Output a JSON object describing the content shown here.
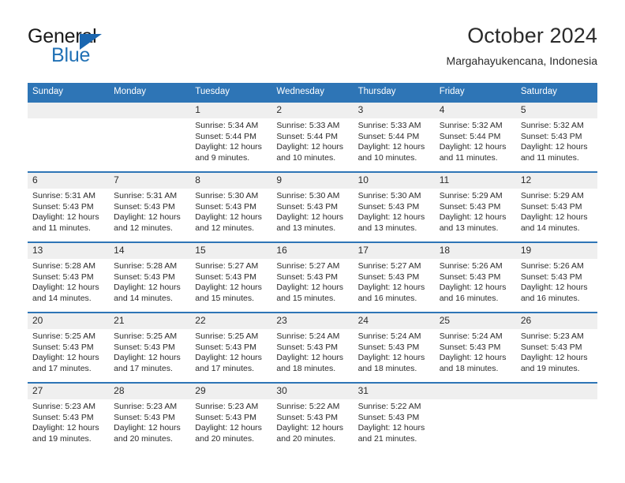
{
  "logo": {
    "word1": "General",
    "word2": "Blue",
    "triangle_color": "#1a66b0",
    "blue_color": "#2171b5"
  },
  "header": {
    "title": "October 2024",
    "subtitle": "Margahayukencana, Indonesia"
  },
  "theme": {
    "header_blue": "#2E75B6",
    "daynum_gray": "#efefef",
    "text": "#2b2b2b"
  },
  "weekdays": [
    "Sunday",
    "Monday",
    "Tuesday",
    "Wednesday",
    "Thursday",
    "Friday",
    "Saturday"
  ],
  "labels": {
    "sunrise": "Sunrise:",
    "sunset": "Sunset:",
    "daylight": "Daylight:"
  },
  "weeks": [
    [
      {
        "day": "",
        "l1": "",
        "l2": "",
        "l3": "",
        "l4": ""
      },
      {
        "day": "",
        "l1": "",
        "l2": "",
        "l3": "",
        "l4": ""
      },
      {
        "day": "1",
        "l1": "Sunrise: 5:34 AM",
        "l2": "Sunset: 5:44 PM",
        "l3": "Daylight: 12 hours",
        "l4": "and 9 minutes."
      },
      {
        "day": "2",
        "l1": "Sunrise: 5:33 AM",
        "l2": "Sunset: 5:44 PM",
        "l3": "Daylight: 12 hours",
        "l4": "and 10 minutes."
      },
      {
        "day": "3",
        "l1": "Sunrise: 5:33 AM",
        "l2": "Sunset: 5:44 PM",
        "l3": "Daylight: 12 hours",
        "l4": "and 10 minutes."
      },
      {
        "day": "4",
        "l1": "Sunrise: 5:32 AM",
        "l2": "Sunset: 5:44 PM",
        "l3": "Daylight: 12 hours",
        "l4": "and 11 minutes."
      },
      {
        "day": "5",
        "l1": "Sunrise: 5:32 AM",
        "l2": "Sunset: 5:43 PM",
        "l3": "Daylight: 12 hours",
        "l4": "and 11 minutes."
      }
    ],
    [
      {
        "day": "6",
        "l1": "Sunrise: 5:31 AM",
        "l2": "Sunset: 5:43 PM",
        "l3": "Daylight: 12 hours",
        "l4": "and 11 minutes."
      },
      {
        "day": "7",
        "l1": "Sunrise: 5:31 AM",
        "l2": "Sunset: 5:43 PM",
        "l3": "Daylight: 12 hours",
        "l4": "and 12 minutes."
      },
      {
        "day": "8",
        "l1": "Sunrise: 5:30 AM",
        "l2": "Sunset: 5:43 PM",
        "l3": "Daylight: 12 hours",
        "l4": "and 12 minutes."
      },
      {
        "day": "9",
        "l1": "Sunrise: 5:30 AM",
        "l2": "Sunset: 5:43 PM",
        "l3": "Daylight: 12 hours",
        "l4": "and 13 minutes."
      },
      {
        "day": "10",
        "l1": "Sunrise: 5:30 AM",
        "l2": "Sunset: 5:43 PM",
        "l3": "Daylight: 12 hours",
        "l4": "and 13 minutes."
      },
      {
        "day": "11",
        "l1": "Sunrise: 5:29 AM",
        "l2": "Sunset: 5:43 PM",
        "l3": "Daylight: 12 hours",
        "l4": "and 13 minutes."
      },
      {
        "day": "12",
        "l1": "Sunrise: 5:29 AM",
        "l2": "Sunset: 5:43 PM",
        "l3": "Daylight: 12 hours",
        "l4": "and 14 minutes."
      }
    ],
    [
      {
        "day": "13",
        "l1": "Sunrise: 5:28 AM",
        "l2": "Sunset: 5:43 PM",
        "l3": "Daylight: 12 hours",
        "l4": "and 14 minutes."
      },
      {
        "day": "14",
        "l1": "Sunrise: 5:28 AM",
        "l2": "Sunset: 5:43 PM",
        "l3": "Daylight: 12 hours",
        "l4": "and 14 minutes."
      },
      {
        "day": "15",
        "l1": "Sunrise: 5:27 AM",
        "l2": "Sunset: 5:43 PM",
        "l3": "Daylight: 12 hours",
        "l4": "and 15 minutes."
      },
      {
        "day": "16",
        "l1": "Sunrise: 5:27 AM",
        "l2": "Sunset: 5:43 PM",
        "l3": "Daylight: 12 hours",
        "l4": "and 15 minutes."
      },
      {
        "day": "17",
        "l1": "Sunrise: 5:27 AM",
        "l2": "Sunset: 5:43 PM",
        "l3": "Daylight: 12 hours",
        "l4": "and 16 minutes."
      },
      {
        "day": "18",
        "l1": "Sunrise: 5:26 AM",
        "l2": "Sunset: 5:43 PM",
        "l3": "Daylight: 12 hours",
        "l4": "and 16 minutes."
      },
      {
        "day": "19",
        "l1": "Sunrise: 5:26 AM",
        "l2": "Sunset: 5:43 PM",
        "l3": "Daylight: 12 hours",
        "l4": "and 16 minutes."
      }
    ],
    [
      {
        "day": "20",
        "l1": "Sunrise: 5:25 AM",
        "l2": "Sunset: 5:43 PM",
        "l3": "Daylight: 12 hours",
        "l4": "and 17 minutes."
      },
      {
        "day": "21",
        "l1": "Sunrise: 5:25 AM",
        "l2": "Sunset: 5:43 PM",
        "l3": "Daylight: 12 hours",
        "l4": "and 17 minutes."
      },
      {
        "day": "22",
        "l1": "Sunrise: 5:25 AM",
        "l2": "Sunset: 5:43 PM",
        "l3": "Daylight: 12 hours",
        "l4": "and 17 minutes."
      },
      {
        "day": "23",
        "l1": "Sunrise: 5:24 AM",
        "l2": "Sunset: 5:43 PM",
        "l3": "Daylight: 12 hours",
        "l4": "and 18 minutes."
      },
      {
        "day": "24",
        "l1": "Sunrise: 5:24 AM",
        "l2": "Sunset: 5:43 PM",
        "l3": "Daylight: 12 hours",
        "l4": "and 18 minutes."
      },
      {
        "day": "25",
        "l1": "Sunrise: 5:24 AM",
        "l2": "Sunset: 5:43 PM",
        "l3": "Daylight: 12 hours",
        "l4": "and 18 minutes."
      },
      {
        "day": "26",
        "l1": "Sunrise: 5:23 AM",
        "l2": "Sunset: 5:43 PM",
        "l3": "Daylight: 12 hours",
        "l4": "and 19 minutes."
      }
    ],
    [
      {
        "day": "27",
        "l1": "Sunrise: 5:23 AM",
        "l2": "Sunset: 5:43 PM",
        "l3": "Daylight: 12 hours",
        "l4": "and 19 minutes."
      },
      {
        "day": "28",
        "l1": "Sunrise: 5:23 AM",
        "l2": "Sunset: 5:43 PM",
        "l3": "Daylight: 12 hours",
        "l4": "and 20 minutes."
      },
      {
        "day": "29",
        "l1": "Sunrise: 5:23 AM",
        "l2": "Sunset: 5:43 PM",
        "l3": "Daylight: 12 hours",
        "l4": "and 20 minutes."
      },
      {
        "day": "30",
        "l1": "Sunrise: 5:22 AM",
        "l2": "Sunset: 5:43 PM",
        "l3": "Daylight: 12 hours",
        "l4": "and 20 minutes."
      },
      {
        "day": "31",
        "l1": "Sunrise: 5:22 AM",
        "l2": "Sunset: 5:43 PM",
        "l3": "Daylight: 12 hours",
        "l4": "and 21 minutes."
      },
      {
        "day": "",
        "l1": "",
        "l2": "",
        "l3": "",
        "l4": ""
      },
      {
        "day": "",
        "l1": "",
        "l2": "",
        "l3": "",
        "l4": ""
      }
    ]
  ]
}
